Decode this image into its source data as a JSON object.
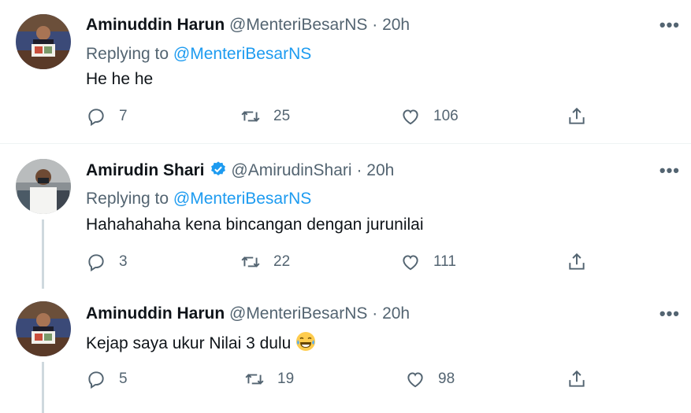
{
  "tweets": [
    {
      "name": "Aminuddin Harun",
      "handle": "@MenteriBesarNS",
      "time": "20h",
      "replying_prefix": "Replying to",
      "replying_to": "@MenteriBesarNS",
      "text": "He he he",
      "replies": "7",
      "retweets": "25",
      "likes": "106",
      "verified": false
    },
    {
      "name": "Amirudin Shari",
      "handle": "@AmirudinShari",
      "time": "20h",
      "replying_prefix": "Replying to",
      "replying_to": "@MenteriBesarNS",
      "text": "Hahahahaha kena bincangan dengan jurunilai",
      "replies": "3",
      "retweets": "22",
      "likes": "111",
      "verified": true
    },
    {
      "name": "Aminuddin Harun",
      "handle": "@MenteriBesarNS",
      "time": "20h",
      "text": "Kejap saya ukur Nilai 3 dulu",
      "replies": "5",
      "retweets": "19",
      "likes": "98",
      "verified": false
    }
  ],
  "separator": "·",
  "more_glyph": "•••",
  "colors": {
    "accent": "#1d9bf0",
    "muted": "#536471",
    "text": "#0f1419",
    "thread_line": "#cfd9de"
  }
}
